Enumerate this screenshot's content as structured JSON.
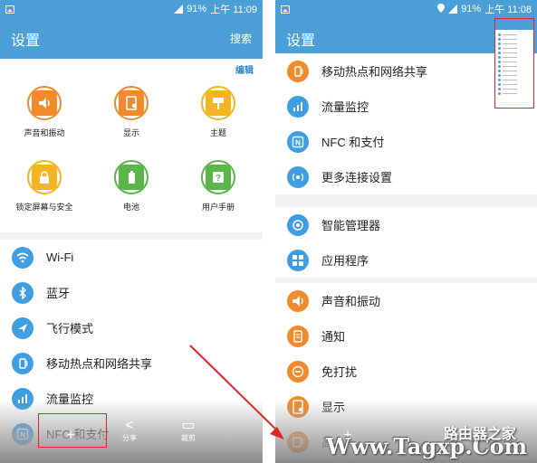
{
  "left": {
    "status": {
      "battery": "91%",
      "time": "上午 11:09"
    },
    "app_bar": {
      "title": "设置",
      "action": "搜索"
    },
    "edit": "编辑",
    "grid": [
      {
        "label": "声音和振动",
        "icon": "speaker-icon",
        "color": "#f08a2a"
      },
      {
        "label": "显示",
        "icon": "display-icon",
        "color": "#f08a2a"
      },
      {
        "label": "主题",
        "icon": "brush-icon",
        "color": "#f3b521"
      },
      {
        "label": "锁定屏幕与安全",
        "icon": "lock-icon",
        "color": "#f3b521"
      },
      {
        "label": "电池",
        "icon": "battery-icon",
        "color": "#5ab54b"
      },
      {
        "label": "用户手册",
        "icon": "help-book-icon",
        "color": "#5ab54b"
      }
    ],
    "list": [
      {
        "label": "Wi-Fi",
        "icon": "wifi-icon",
        "color": "#3f9ee3"
      },
      {
        "label": "蓝牙",
        "icon": "bluetooth-icon",
        "color": "#3f9ee3"
      },
      {
        "label": "飞行模式",
        "icon": "airplane-icon",
        "color": "#3f9ee3"
      },
      {
        "label": "移动热点和网络共享",
        "icon": "hotspot-icon",
        "color": "#3f9ee3"
      },
      {
        "label": "流量监控",
        "icon": "data-usage-icon",
        "color": "#3f9ee3"
      },
      {
        "label": "NFC 和支付",
        "icon": "nfc-icon",
        "color": "#3f9ee3"
      }
    ],
    "toolbar": [
      {
        "label": "",
        "glyph": "+",
        "icon": "add-icon"
      },
      {
        "label": "分享",
        "glyph": "<",
        "icon": "share-icon"
      },
      {
        "label": "裁剪",
        "glyph": "▭",
        "icon": "crop-icon"
      }
    ]
  },
  "right": {
    "status": {
      "battery": "91%",
      "time": "上午 11:08"
    },
    "app_bar": {
      "title": "设置"
    },
    "group1": [
      {
        "label": "移动热点和网络共享",
        "icon": "hotspot-icon",
        "color": "#f08a2a"
      },
      {
        "label": "流量监控",
        "icon": "data-usage-icon",
        "color": "#3f9ee3"
      },
      {
        "label": "NFC 和支付",
        "icon": "nfc-icon",
        "color": "#3f9ee3"
      },
      {
        "label": "更多连接设置",
        "icon": "more-connections-icon",
        "color": "#3f9ee3"
      }
    ],
    "group2": [
      {
        "label": "智能管理器",
        "icon": "smart-manager-icon",
        "color": "#3f9ee3"
      },
      {
        "label": "应用程序",
        "icon": "apps-icon",
        "color": "#3f9ee3"
      }
    ],
    "group3": [
      {
        "label": "声音和振动",
        "icon": "speaker-icon",
        "color": "#f08a2a"
      },
      {
        "label": "通知",
        "icon": "notification-icon",
        "color": "#f08a2a"
      },
      {
        "label": "免打扰",
        "icon": "do-not-disturb-icon",
        "color": "#f08a2a"
      },
      {
        "label": "显示",
        "icon": "display-icon",
        "color": "#f08a2a"
      },
      {
        "label": "高",
        "icon": "advanced-icon",
        "color": "#f08a2a"
      }
    ]
  },
  "watermark": {
    "text": "Www.Tagxp.Com",
    "text_cn": "路由器之家"
  }
}
